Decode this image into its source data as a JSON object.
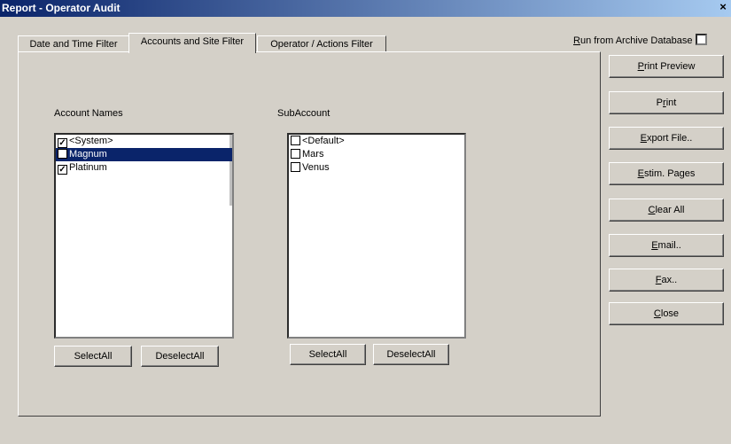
{
  "window": {
    "title": "Report  - Operator Audit",
    "close_glyph": "×"
  },
  "tabs": [
    {
      "label": "Date and Time Filter"
    },
    {
      "label": "Accounts and Site Filter"
    },
    {
      "label": "Operator / Actions Filter"
    }
  ],
  "archive": {
    "prefix": "R",
    "rest": "un from Archive Database",
    "checked": false
  },
  "accounts": {
    "label": "Account Names",
    "items": [
      {
        "label": "<System>",
        "checked": true,
        "selected": false
      },
      {
        "label": "Magnum",
        "checked": false,
        "selected": true
      },
      {
        "label": "Platinum",
        "checked": true,
        "selected": false
      }
    ],
    "select_all": "SelectAll",
    "deselect_all": "DeselectAll"
  },
  "subaccounts": {
    "label": "SubAccount",
    "items": [
      {
        "label": "<Default>",
        "checked": false
      },
      {
        "label": "Mars",
        "checked": false
      },
      {
        "label": "Venus",
        "checked": false
      }
    ],
    "select_all": "SelectAll",
    "deselect_all": "DeselectAll"
  },
  "side_buttons": [
    {
      "mn": "P",
      "rest": "rint Preview"
    },
    {
      "pre": "P",
      "mn": "r",
      "rest": "int"
    },
    {
      "mn": "E",
      "rest": "xport File.."
    },
    {
      "mn": "E",
      "rest": "stim. Pages"
    },
    {
      "mn": "C",
      "rest": "lear All"
    },
    {
      "mn": "E",
      "rest": "mail.."
    },
    {
      "mn": "F",
      "rest": "ax.."
    },
    {
      "mn": "C",
      "rest": "lose"
    }
  ]
}
